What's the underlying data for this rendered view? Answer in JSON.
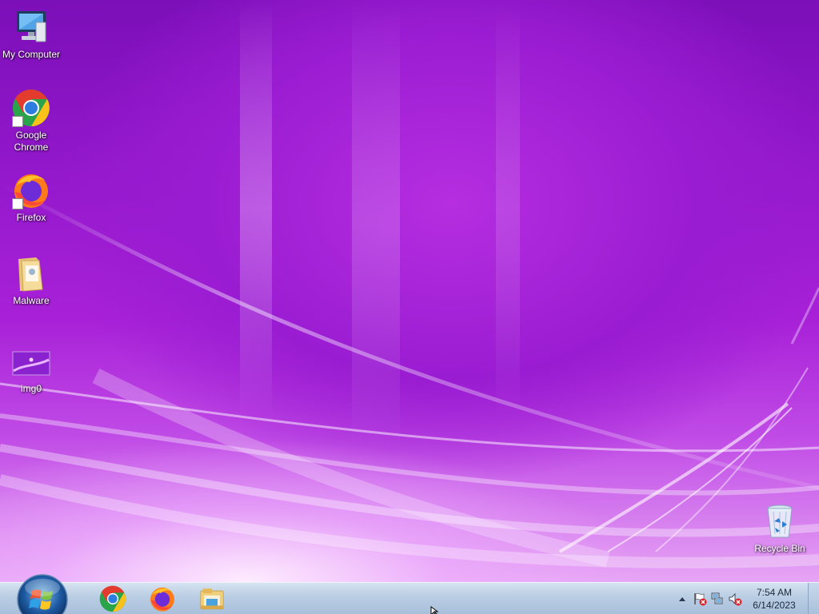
{
  "desktop": {
    "icons": [
      {
        "label": "My Computer",
        "icon": "computer-icon"
      },
      {
        "label": "Google\nChrome",
        "icon": "chrome-icon"
      },
      {
        "label": "Firefox",
        "icon": "firefox-icon"
      },
      {
        "label": "Malware",
        "icon": "folder-icon"
      },
      {
        "label": "img0",
        "icon": "image-file-icon"
      },
      {
        "label": "Recycle Bin",
        "icon": "recycle-bin-icon"
      }
    ]
  },
  "taskbar": {
    "start": {
      "icon": "windows-start-orb-icon"
    },
    "pinned": [
      {
        "icon": "chrome-icon"
      },
      {
        "icon": "firefox-icon"
      },
      {
        "icon": "file-explorer-icon"
      }
    ],
    "tray": {
      "icons": [
        "show-hidden-icons-chevron",
        "action-center-flag-icon",
        "network-icon",
        "volume-muted-icon"
      ],
      "time": "7:54 AM",
      "date": "6/14/2023"
    }
  },
  "colors": {
    "wallpaper_primary": "#9a1cd2",
    "wallpaper_light": "#e7a5f5",
    "taskbar": "#b9cde3"
  }
}
